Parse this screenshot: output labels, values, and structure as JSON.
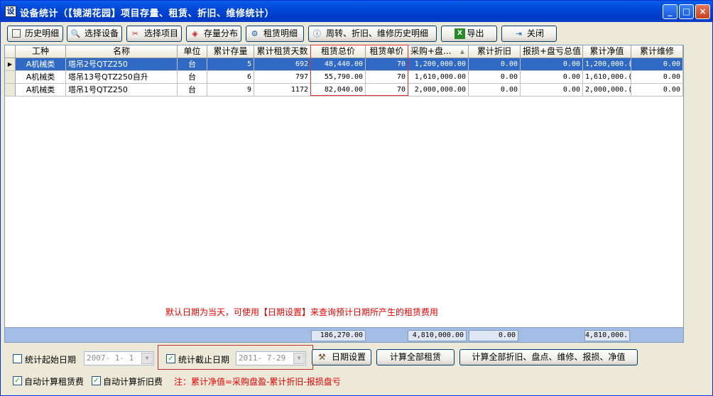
{
  "window": {
    "title": "设备统计（【镜湖花园】项目存量、租赁、折旧、维修统计）",
    "icon_text": "设",
    "min_glyph": "_",
    "max_glyph": "□",
    "close_glyph": "×"
  },
  "toolbar": {
    "history": "历史明细",
    "select_equipment": "选择设备",
    "select_project": "选择项目",
    "stock_dist": "存量分布",
    "rental_detail": "租赁明细",
    "turnover_history": "周转、折旧、维修历史明细",
    "export": "导出",
    "close": "关闭"
  },
  "grid": {
    "columns": [
      "工种",
      "名称",
      "单位",
      "累计存量",
      "累计租赁天数",
      "租赁总价",
      "租赁单价",
      "采购+盘...",
      "累计折旧",
      "报损+盘亏总值",
      "累计净值",
      "累计维修"
    ],
    "sort_glyph": "▲",
    "row_pointer": "▶",
    "rows": [
      {
        "type": "A机械类",
        "name": "塔吊2号QTZ250",
        "unit": "台",
        "stock": "5",
        "days": "692",
        "total": "48,440.00",
        "price": "70",
        "purchase": "1,200,000.00",
        "depr": "0.00",
        "loss": "0.00",
        "net": "1,200,000.(",
        "repair": "0.00"
      },
      {
        "type": "A机械类",
        "name": "塔吊13号QTZ250自升",
        "unit": "台",
        "stock": "6",
        "days": "797",
        "total": "55,790.00",
        "price": "70",
        "purchase": "1,610,000.00",
        "depr": "0.00",
        "loss": "0.00",
        "net": "1,610,000.(",
        "repair": "0.00"
      },
      {
        "type": "A机械类",
        "name": "塔吊1号QTZ250",
        "unit": "台",
        "stock": "9",
        "days": "1172",
        "total": "82,040.00",
        "price": "70",
        "purchase": "2,000,000.00",
        "depr": "0.00",
        "loss": "0.00",
        "net": "2,000,000.(",
        "repair": "0.00"
      }
    ],
    "hint": "默认日期为当天，可使用【日期设置】来查询预计日期所产生的租赁费用"
  },
  "totals": {
    "rental_total": "186,270.00",
    "purchase_total": "4,810,000.00",
    "depr_total": "0.00",
    "net_total": "4,810,000."
  },
  "bottom": {
    "start_label": "统计起始日期",
    "start_date": "2007- 1- 1",
    "end_label": "统计截止日期",
    "end_date": "2011- 7-29",
    "date_settings": "日期设置",
    "calc_rent": "计算全部租赁",
    "calc_all": "计算全部折旧、盘点、维修、报损、净值",
    "auto_rent": "自动计算租赁费",
    "auto_depr": "自动计算折旧费",
    "note": "注：累计净值=采购盘盈-累计折旧-报损盘亏"
  },
  "colors": {
    "titlebar": "#0047d8",
    "selection": "#316ac5",
    "highlight_red": "#e03030",
    "note_red": "#e00000"
  }
}
